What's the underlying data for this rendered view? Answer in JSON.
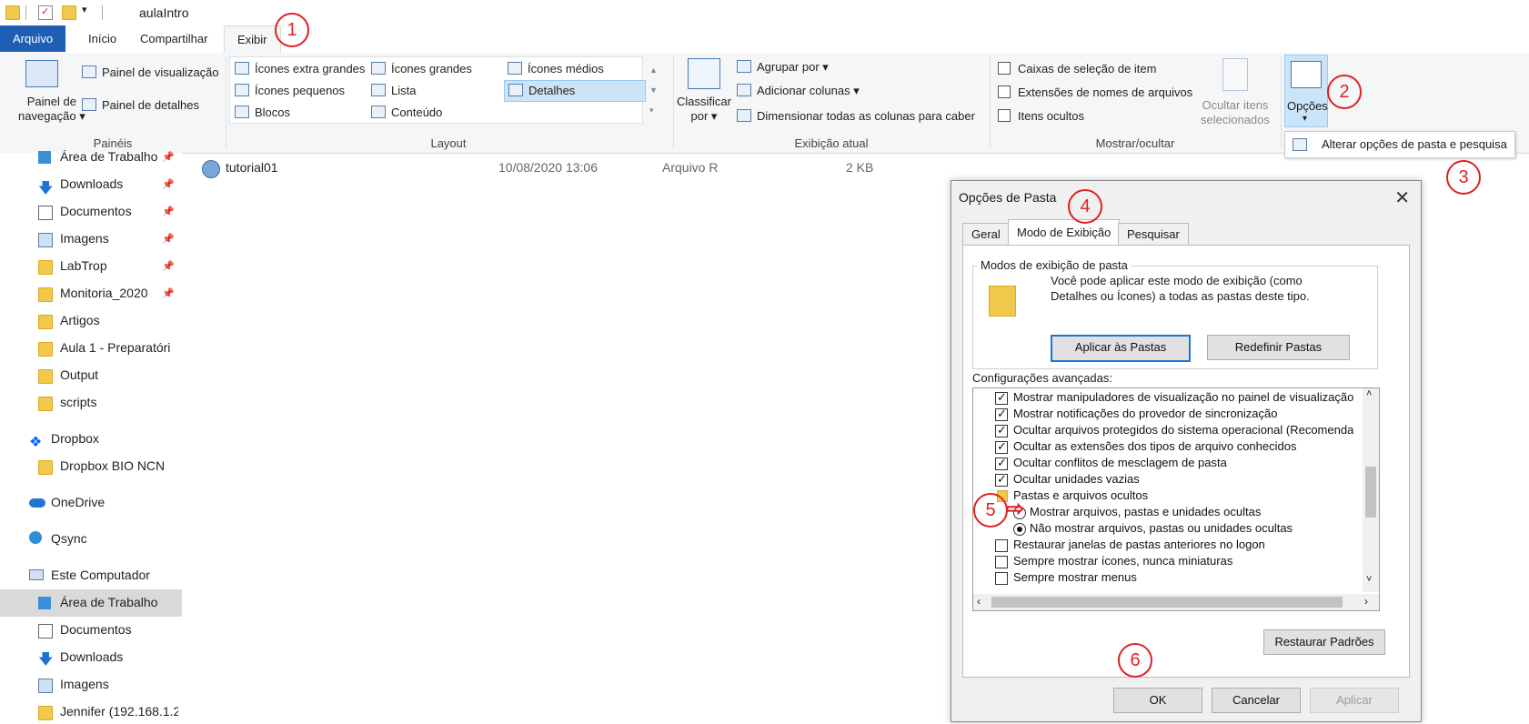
{
  "window": {
    "title": "aulaIntro"
  },
  "tabs": [
    "Arquivo",
    "Início",
    "Compartilhar",
    "Exibir"
  ],
  "ribbon": {
    "paineis": {
      "label": "Painéis",
      "painel_navegacao": "Painel de\nnavegação",
      "painel_navegacao_l1": "Painel de",
      "painel_navegacao_l2": "navegação",
      "painel_visualizacao": "Painel de visualização",
      "painel_detalhes": "Painel de detalhes"
    },
    "layout": {
      "label": "Layout",
      "items": [
        "Ícones extra grandes",
        "Ícones grandes",
        "Ícones médios",
        "Ícones pequenos",
        "Lista",
        "Detalhes",
        "Blocos",
        "Conteúdo"
      ]
    },
    "exibicao_atual": {
      "label": "Exibição atual",
      "classificar_l1": "Classificar",
      "classificar_l2": "por",
      "agrupar": "Agrupar por",
      "adicionar_colunas": "Adicionar colunas",
      "dimensionar": "Dimensionar todas as colunas para caber"
    },
    "mostrar_ocultar": {
      "label": "Mostrar/ocultar",
      "caixas": "Caixas de seleção de item",
      "extensoes": "Extensões de nomes de arquivos",
      "itens_ocultos": "Itens ocultos",
      "ocultar_l1": "Ocultar itens",
      "ocultar_l2": "selecionados"
    },
    "opcoes": {
      "label": "Opções",
      "dropdown_item": "Alterar opções de pasta e pesquisa"
    }
  },
  "sidebar": {
    "items": [
      "Área de Trabalho",
      "Downloads",
      "Documentos",
      "Imagens",
      "LabTrop",
      "Monitoria_2020",
      "Artigos",
      "Aula 1 - Preparatóri",
      "Output",
      "scripts",
      "Dropbox",
      "Dropbox BIO NCN",
      "OneDrive",
      "Qsync",
      "Este Computador",
      "Área de Trabalho",
      "Documentos",
      "Downloads",
      "Imagens",
      "Jennifer (192.168.1.2"
    ]
  },
  "file": {
    "name": "tutorial01",
    "date": "10/08/2020 13:06",
    "type": "Arquivo R",
    "size": "2 KB"
  },
  "dialog": {
    "title": "Opções de Pasta",
    "tabs": [
      "Geral",
      "Modo de Exibição",
      "Pesquisar"
    ],
    "modos_legend": "Modos de exibição de pasta",
    "modos_text_l1": "Você pode aplicar este modo de exibição (como",
    "modos_text_l2": "Detalhes ou Ícones) a todas as pastas deste tipo.",
    "aplicar_pastas": "Aplicar às Pastas",
    "redefinir_pastas": "Redefinir Pastas",
    "config_label": "Configurações avançadas:",
    "advanced": [
      "Mostrar manipuladores de visualização no painel de visualização",
      "Mostrar notificações do provedor de sincronização",
      "Ocultar arquivos protegidos do sistema operacional (Recomendado)",
      "Ocultar as extensões dos tipos de arquivo conhecidos",
      "Ocultar conflitos de mesclagem de pasta",
      "Ocultar unidades vazias",
      "Pastas e arquivos ocultos",
      "Mostrar arquivos, pastas e unidades ocultas",
      "Não mostrar arquivos, pastas ou unidades ocultas",
      "Restaurar janelas de pastas anteriores no logon",
      "Sempre mostrar ícones, nunca miniaturas",
      "Sempre mostrar menus"
    ],
    "restaurar_padroes": "Restaurar Padrões",
    "ok": "OK",
    "cancelar": "Cancelar",
    "aplicar": "Aplicar"
  },
  "annotations": [
    "1",
    "2",
    "3",
    "4",
    "5",
    "6"
  ],
  "colors": {
    "accent": "#1e5fb4",
    "annotation": "#e02020"
  }
}
